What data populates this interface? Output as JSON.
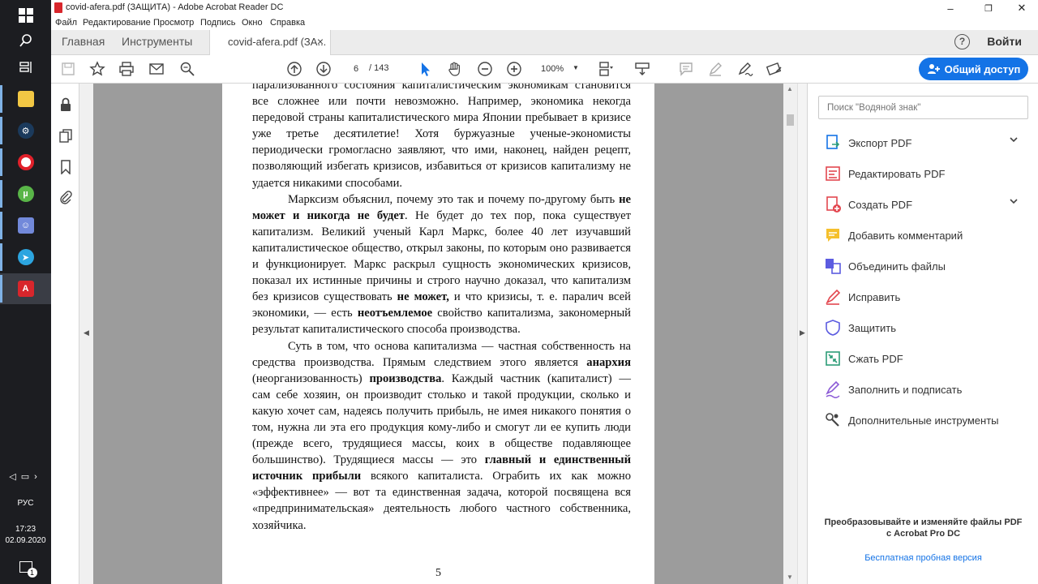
{
  "window": {
    "title": "covid-afera.pdf (ЗАЩИТА) - Adobe Acrobat Reader DC",
    "minimize": "–",
    "maximize": "❐",
    "close": "✕"
  },
  "menu": [
    "Файл",
    "Редактирование",
    "Просмотр",
    "Подпись",
    "Окно",
    "Справка"
  ],
  "tabs": {
    "home": "Главная",
    "tools": "Инструменты",
    "document": "covid-afera.pdf (ЗА...",
    "close": "×",
    "help": "?",
    "signin": "Войти"
  },
  "toolbar": {
    "page_current": "6",
    "page_total": "/ 143",
    "zoom": "100%",
    "share_label": "Общий доступ"
  },
  "taskbar": {
    "language": "РУС",
    "time": "17:23",
    "date": "02.09.2020",
    "notification_count": "1"
  },
  "document": {
    "page_number": "5",
    "paragraphs": [
      [
        {
          "t": "парализованного состояния капиталистическим экономикам становится все сложнее или почти невозможно. Например, экономика некогда передовой страны капиталистического мира Японии пребывает в кризисе уже третье десятилетие! Хотя буржуазные ученые-экономисты периодически громогласно заявляют, что ими, наконец, найден рецепт, позволяющий избегать кризисов, избавиться от кризисов капитализму не удается никакими способами."
        }
      ],
      [
        {
          "t": "Марксизм объяснил, почему это так и почему по-другому быть "
        },
        {
          "t": "не может и никогда не будет",
          "b": true
        },
        {
          "t": ". Не будет до тех пор, пока существует капитализм. Великий ученый Карл Маркс, более 40 лет изучавший капиталистическое общество, открыл законы, по которым оно развивается и функционирует. Маркс раскрыл сущность экономических кризисов, показал их истинные причины и строго научно доказал, что капитализм без кризисов существовать "
        },
        {
          "t": "не может,",
          "b": true
        },
        {
          "t": " и что кризисы, т. е. паралич всей экономики, — есть "
        },
        {
          "t": "неотъемлемое",
          "b": true
        },
        {
          "t": " свойство капитализма, закономерный результат капиталистического способа производства."
        }
      ],
      [
        {
          "t": "Суть в том, что основа капитализма — частная собственность на средства производства. Прямым следствием этого является "
        },
        {
          "t": "анархия",
          "b": true
        },
        {
          "t": " (неорганизованность) "
        },
        {
          "t": "производства",
          "b": true
        },
        {
          "t": ". Каждый частник (капиталист) — сам себе хозяин, он производит столько и такой продукции, сколько и какую хочет сам, надеясь получить прибыль, не имея никакого понятия о том, нужна ли эта его продукция кому-либо и смогут ли ее купить люди (прежде всего, трудящиеся массы, коих в обществе подавляющее большинство). Трудящиеся массы — это "
        },
        {
          "t": "главный и единственный источник прибыли",
          "b": true
        },
        {
          "t": " всякого капиталиста. Ограбить их как можно «эффективнее» — вот та единственная задача, которой посвящена вся «предпринимательская» деятельность любого частного собственника, хозяйчика."
        }
      ]
    ]
  },
  "right_panel": {
    "search_placeholder": "Поиск \"Водяной знак\"",
    "tools": [
      {
        "label": "Экспорт PDF",
        "icon": "export-pdf-icon",
        "color": "#1473e6",
        "expandable": true
      },
      {
        "label": "Редактировать PDF",
        "icon": "edit-pdf-icon",
        "color": "#e34850",
        "expandable": false
      },
      {
        "label": "Создать PDF",
        "icon": "create-pdf-icon",
        "color": "#e34850",
        "expandable": true
      },
      {
        "label": "Добавить комментарий",
        "icon": "comment-icon",
        "color": "#f5c02d",
        "expandable": false
      },
      {
        "label": "Объединить файлы",
        "icon": "combine-files-icon",
        "color": "#5c5ce0",
        "expandable": false
      },
      {
        "label": "Исправить",
        "icon": "fix-icon",
        "color": "#e34850",
        "expandable": false
      },
      {
        "label": "Защитить",
        "icon": "protect-icon",
        "color": "#5c5ce0",
        "expandable": false
      },
      {
        "label": "Сжать PDF",
        "icon": "compress-pdf-icon",
        "color": "#2d9d78",
        "expandable": false
      },
      {
        "label": "Заполнить и подписать",
        "icon": "fill-sign-icon",
        "color": "#8c5cd6",
        "expandable": false
      },
      {
        "label": "Дополнительные инструменты",
        "icon": "more-tools-icon",
        "color": "#444444",
        "expandable": false
      }
    ],
    "promo_line1": "Преобразовывайте и изменяйте файлы PDF",
    "promo_line2": "с Acrobat Pro DC",
    "trial_link": "Бесплатная пробная версия"
  },
  "colors": {
    "accent": "#1473e6",
    "taskbar": "#1c1d21",
    "doc_background": "#9c9c9c"
  }
}
